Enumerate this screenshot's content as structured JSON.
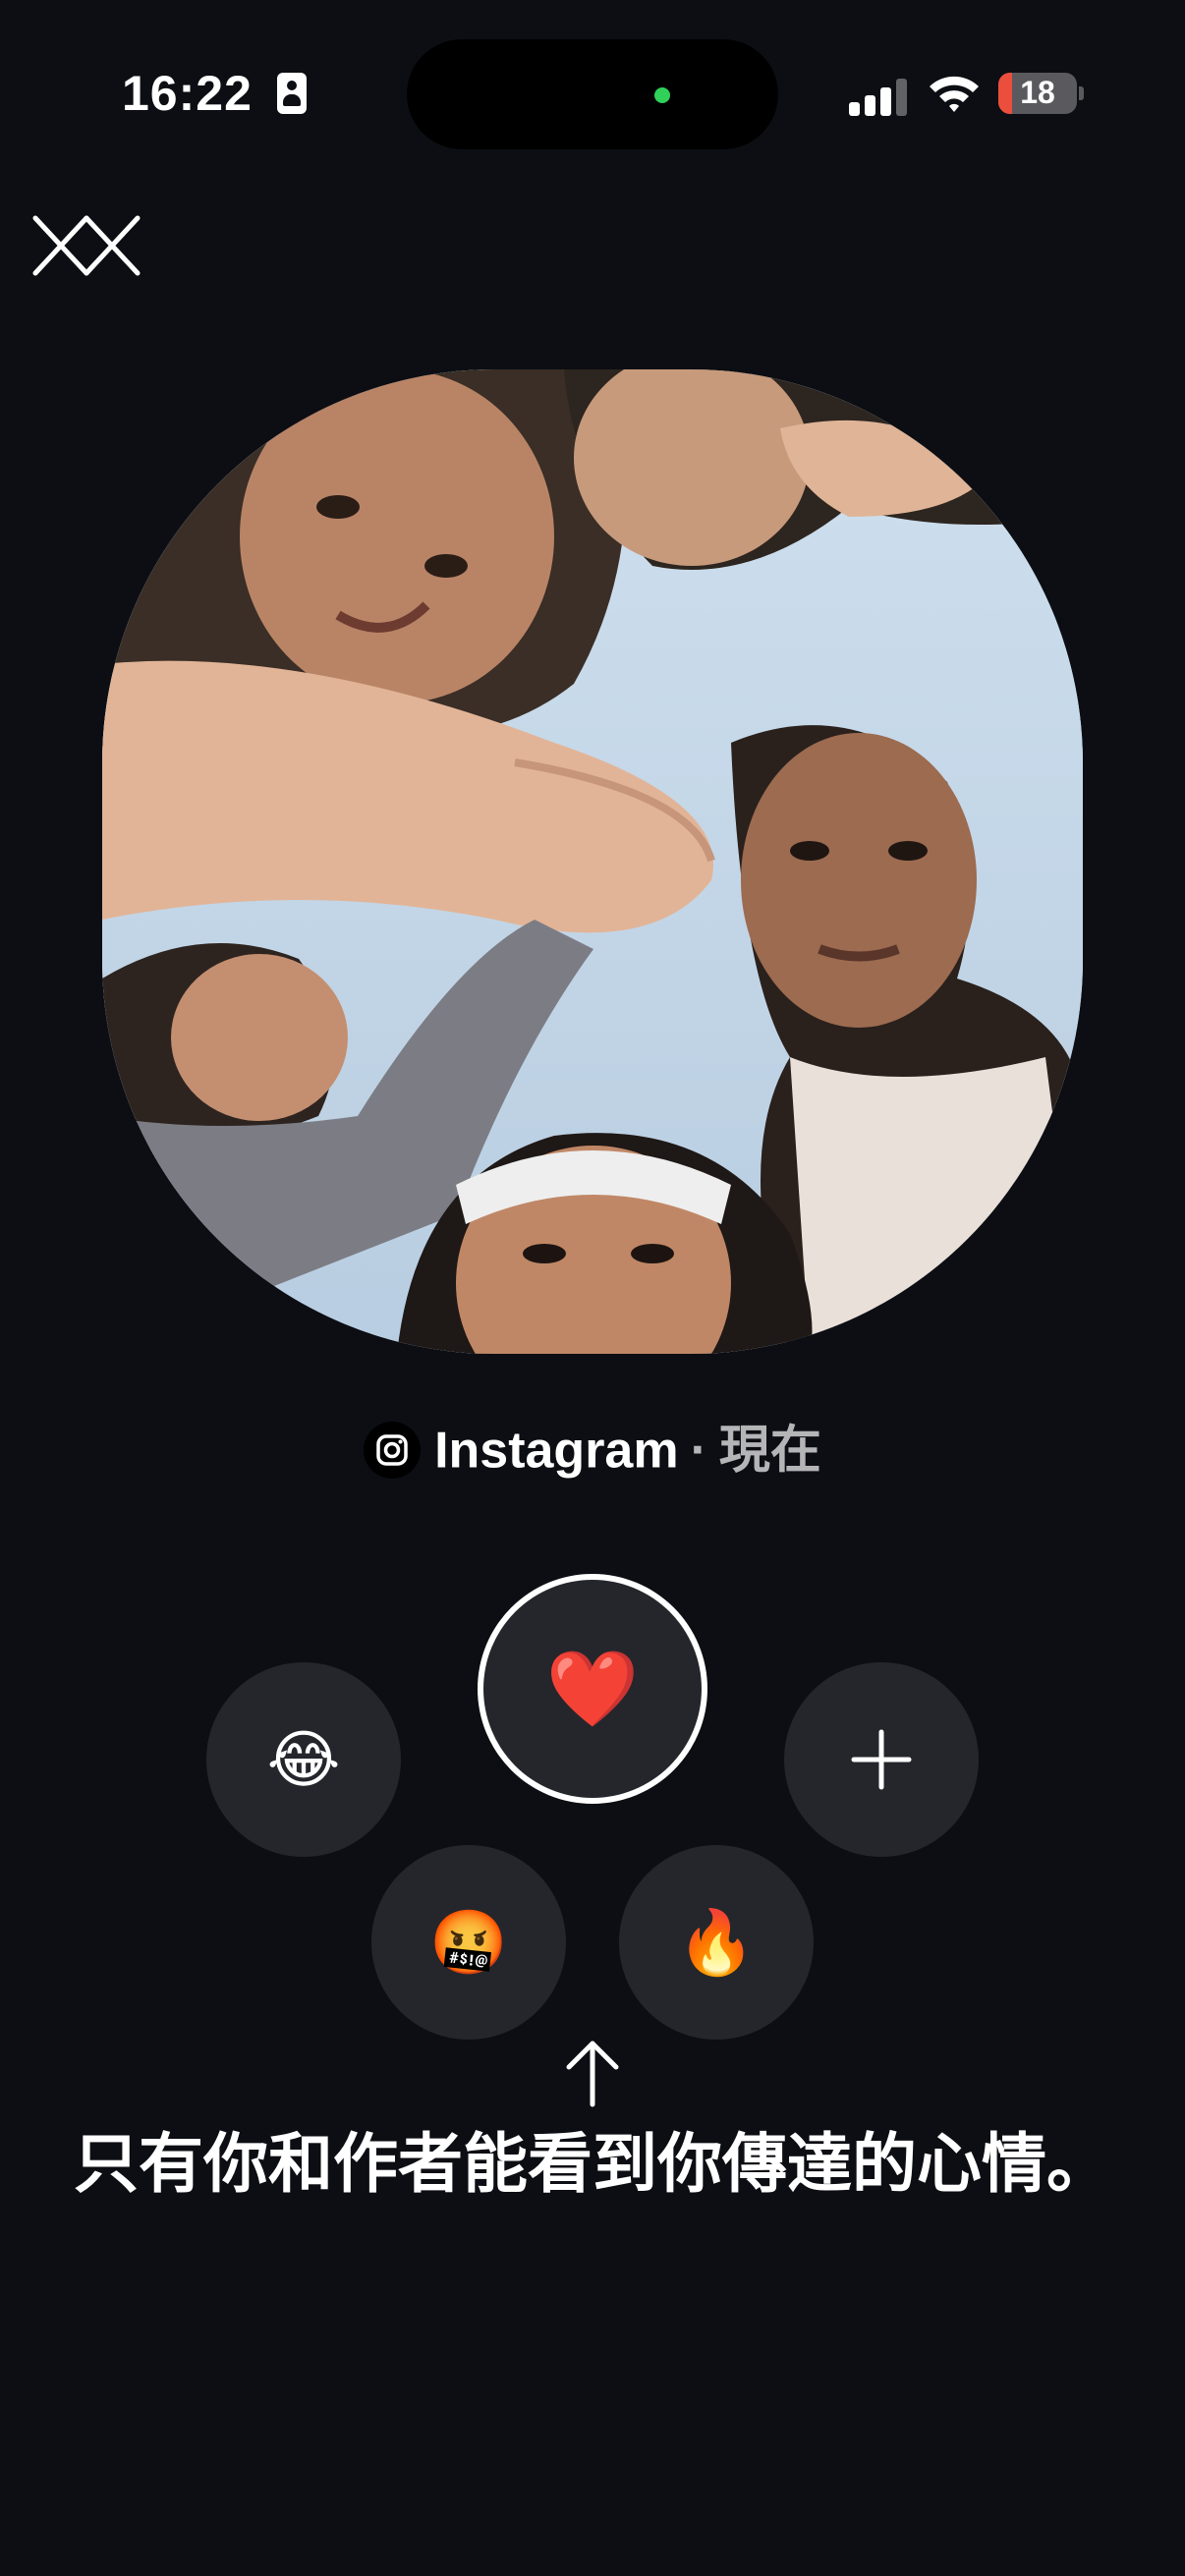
{
  "status_bar": {
    "time": "16:22",
    "battery_level": "18",
    "battery_fraction": 0.18,
    "icons": [
      "id-card-icon",
      "signal-icon",
      "wifi-icon",
      "battery-icon"
    ]
  },
  "header": {
    "close_icon": "close-icon"
  },
  "post": {
    "image_alt": "group photo",
    "source_icon": "instagram-icon",
    "source_name": "Instagram",
    "separator": "·",
    "time": "現在"
  },
  "reactions": [
    {
      "emoji": "😂",
      "name": "laugh"
    },
    {
      "emoji": "❤️",
      "name": "heart",
      "selected": true
    },
    {
      "emoji": "+",
      "name": "add-reaction"
    },
    {
      "emoji": "🤬",
      "name": "angry"
    },
    {
      "emoji": "🔥",
      "name": "fire"
    }
  ],
  "hint": {
    "arrow_icon": "arrow-up-icon",
    "text": "只有你和作者能看到你傳達的心情。"
  },
  "colors": {
    "background": "#0c0e13",
    "button": "#24262b",
    "battery_low": "#eb4e3d",
    "active_dot": "#30d158"
  }
}
